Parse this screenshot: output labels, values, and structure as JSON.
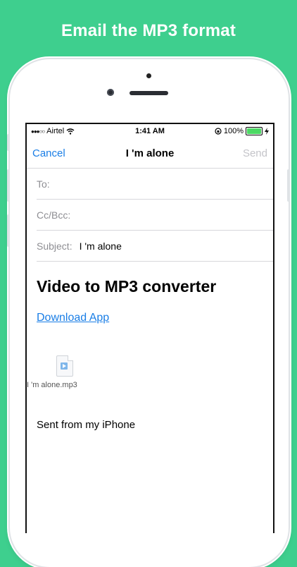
{
  "headline": "Email the MP3 format",
  "status_bar": {
    "carrier": "Airtel",
    "signal_dots": "●●●○○",
    "time": "1:41 AM",
    "battery_percent": "100%",
    "battery_level": 1.0
  },
  "nav": {
    "cancel_label": "Cancel",
    "title": "I 'm alone",
    "send_label": "Send"
  },
  "fields": {
    "to_label": "To:",
    "ccbcc_label": "Cc/Bcc:",
    "subject_label": "Subject:",
    "subject_value": "I 'm alone"
  },
  "body": {
    "heading": "Video to MP3 converter",
    "link_text": "Download App",
    "attachment_name": "I 'm alone.mp3",
    "signature": "Sent from my iPhone"
  },
  "colors": {
    "background": "#3ecf8e",
    "accent": "#1a7ee6",
    "battery": "#4cd964",
    "disabled": "#c4c4c9"
  }
}
